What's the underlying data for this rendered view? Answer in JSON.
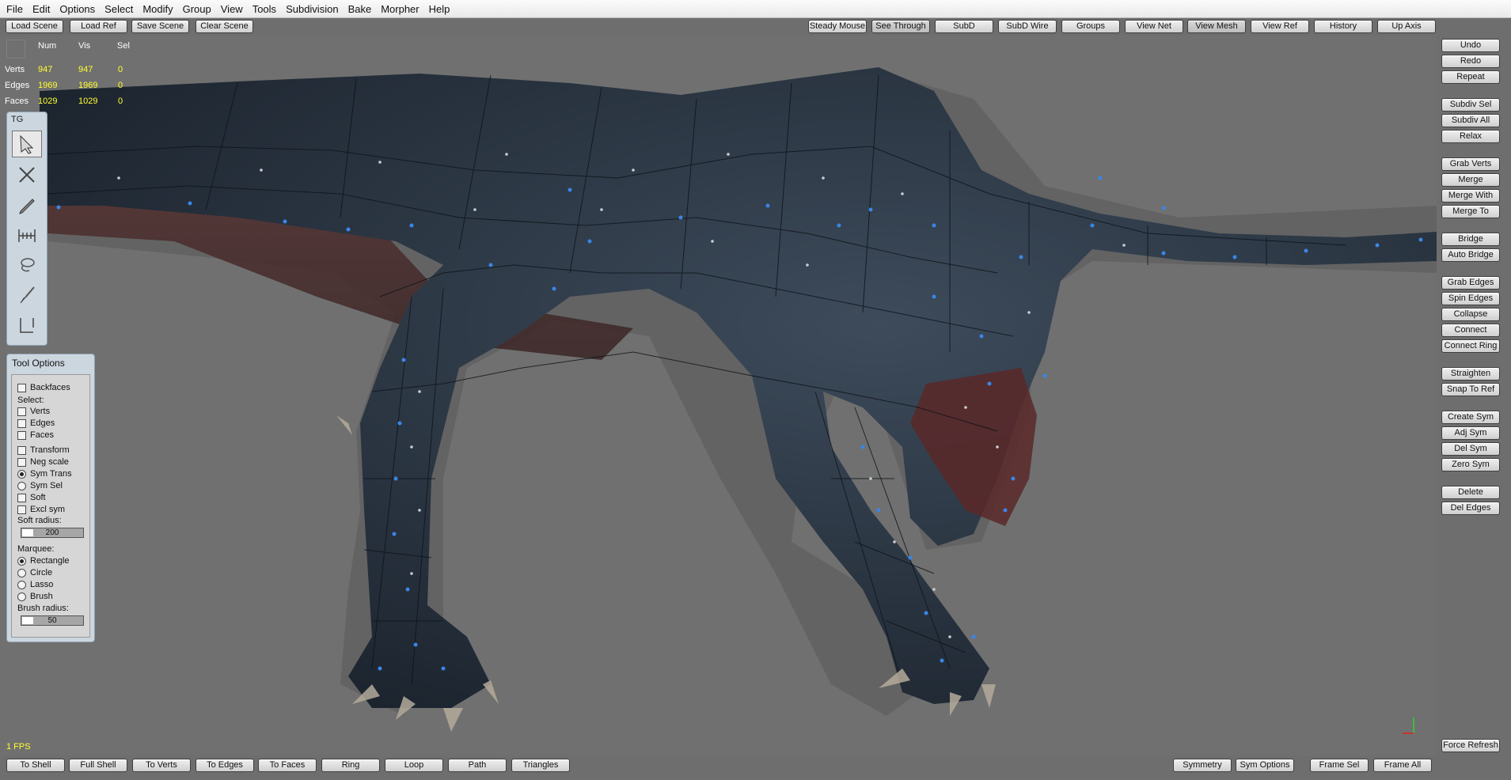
{
  "menu": [
    "File",
    "Edit",
    "Options",
    "Select",
    "Modify",
    "Group",
    "View",
    "Tools",
    "Subdivision",
    "Bake",
    "Morpher",
    "Help"
  ],
  "top_left_buttons": [
    "Load Scene",
    "Load Ref",
    "Save Scene",
    "Clear Scene"
  ],
  "top_right_buttons": [
    "Steady Mouse",
    "See Through",
    "SubD",
    "SubD Wire",
    "Groups",
    "View Net",
    "View Mesh",
    "View Ref",
    "History",
    "Up Axis"
  ],
  "stats": {
    "headers": [
      "Num",
      "Vis",
      "Sel"
    ],
    "rows": [
      {
        "label": "Verts",
        "num": "947",
        "vis": "947",
        "sel": "0"
      },
      {
        "label": "Edges",
        "num": "1969",
        "vis": "1969",
        "sel": "0"
      },
      {
        "label": "Faces",
        "num": "1029",
        "vis": "1029",
        "sel": "0"
      }
    ]
  },
  "tool_panel": {
    "title": "TG",
    "tools": [
      "arrow-select-tool-icon",
      "tweak-cross-tool-icon",
      "pen-tool-icon",
      "ruler-tool-icon",
      "lasso-tool-icon",
      "brush-tool-icon",
      "bracket-tool-icon"
    ]
  },
  "tool_options": {
    "title": "Tool Options",
    "backfaces": "Backfaces",
    "select_label": "Select:",
    "select_items": [
      "Verts",
      "Edges",
      "Faces"
    ],
    "transform": "Transform",
    "neg_scale": "Neg scale",
    "sym_trans": "Sym Trans",
    "sym_sel": "Sym Sel",
    "soft": "Soft",
    "excl_sym": "Excl sym",
    "soft_radius_label": "Soft radius:",
    "soft_radius": "200",
    "marquee_label": "Marquee:",
    "marquee_items": [
      "Rectangle",
      "Circle",
      "Lasso",
      "Brush"
    ],
    "marquee_selected": "Rectangle",
    "brush_radius_label": "Brush radius:",
    "brush_radius": "50"
  },
  "right_buttons": {
    "group1": [
      "Undo",
      "Redo",
      "Repeat"
    ],
    "group2": [
      "Subdiv Sel",
      "Subdiv All",
      "Relax"
    ],
    "group3": [
      "Grab Verts",
      "Merge",
      "Merge With",
      "Merge To"
    ],
    "group4": [
      "Bridge",
      "Auto Bridge"
    ],
    "group5": [
      "Grab Edges",
      "Spin Edges",
      "Collapse",
      "Connect",
      "Connect Ring"
    ],
    "group6": [
      "Straighten",
      "Snap To Ref"
    ],
    "group7": [
      "Create Sym",
      "Adj Sym",
      "Del Sym",
      "Zero Sym"
    ],
    "group8": [
      "Delete",
      "Del Edges"
    ],
    "force_refresh": "Force Refresh"
  },
  "bottom_left_buttons": [
    "To Shell",
    "Full Shell",
    "To Verts",
    "To Edges",
    "To Faces",
    "Ring",
    "Loop",
    "Path",
    "Triangles"
  ],
  "bottom_right_buttons": [
    "Symmetry",
    "Sym Options",
    "Frame Sel",
    "Frame All"
  ],
  "fps": "1 FPS",
  "colors": {
    "background": "#6e6e6e",
    "viewport": "#707070",
    "mesh_body": "#2a3644",
    "mesh_under": "#4a2a2a",
    "vertex_blue": "#3a86e8",
    "stats_yellow": "#ffff30",
    "panel": "#ccd6df"
  }
}
